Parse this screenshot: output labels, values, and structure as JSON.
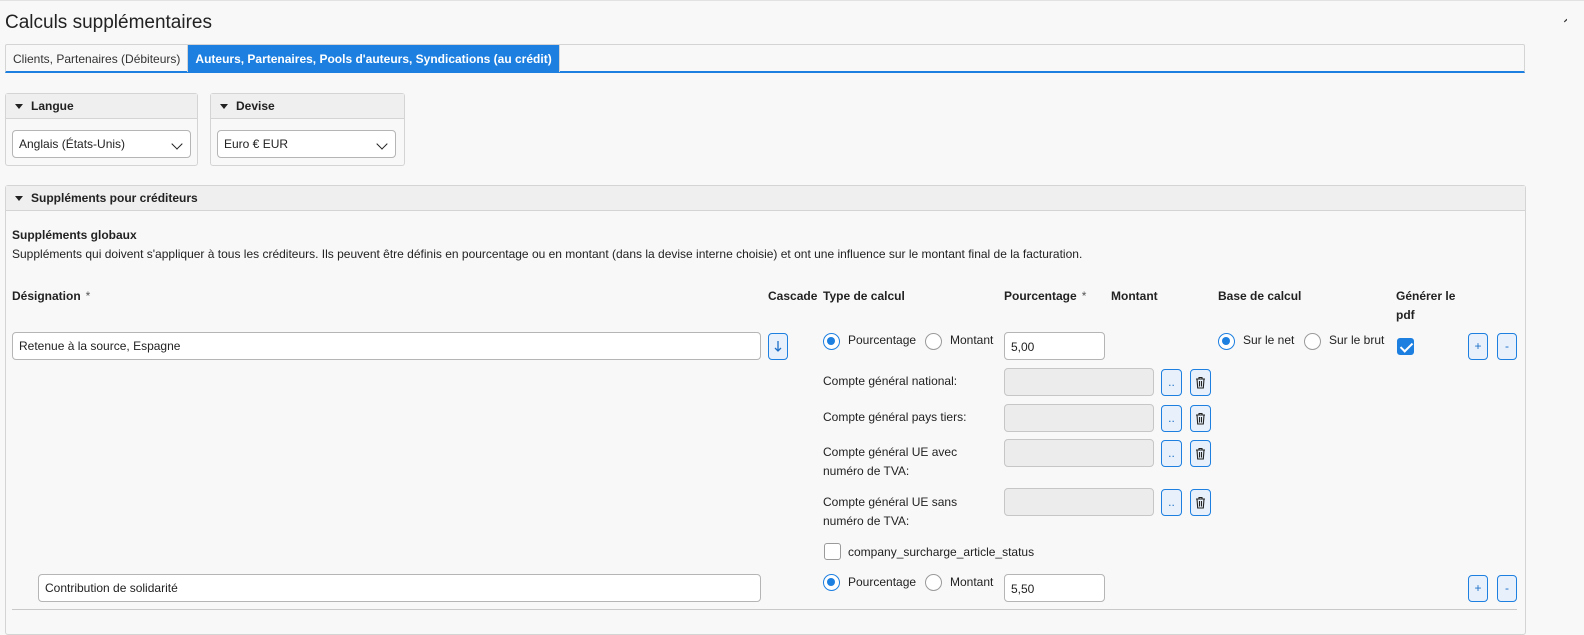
{
  "page": {
    "title": "Calculs supplémentaires"
  },
  "tabs": [
    {
      "label": "Clients, Partenaires (Débiteurs)",
      "active": false
    },
    {
      "label": "Auteurs, Partenaires, Pools d'auteurs, Syndications (au crédit)",
      "active": true
    }
  ],
  "langue": {
    "title": "Langue",
    "selected": "Anglais (États-Unis)"
  },
  "devise": {
    "title": "Devise",
    "selected": "Euro € EUR"
  },
  "supplements": {
    "title": "Suppléments pour créditeurs",
    "global_title": "Suppléments globaux",
    "global_desc": "Suppléments qui doivent s'appliquer à tous les créditeurs. Ils peuvent être définis en pourcentage ou en montant (dans la devise interne choisie) et ont une influence sur le montant final de la facturation.",
    "columns": {
      "designation": "Désignation",
      "required_mark": "*",
      "cascade": "Cascade",
      "type_calcul": "Type de calcul",
      "pourcentage": "Pourcentage",
      "montant": "Montant",
      "base_calcul": "Base de calcul",
      "generer_pdf_1": "Générer le",
      "generer_pdf_2": "pdf"
    },
    "options": {
      "pourcentage": "Pourcentage",
      "montant": "Montant",
      "sur_net": "Sur le net",
      "sur_brut": "Sur le brut"
    },
    "rows": [
      {
        "designation": "Retenue à la source, Espagne",
        "cascade_icon": "arrow-down-icon",
        "type": "pourcentage",
        "pourcentage": "5,00",
        "base": "net",
        "generer_pdf": true,
        "accounts": [
          {
            "label1": "Compte général national:",
            "label2": ""
          },
          {
            "label1": "Compte général pays tiers:",
            "label2": ""
          },
          {
            "label1": "Compte général UE avec",
            "label2": "numéro de TVA:"
          },
          {
            "label1": "Compte général UE sans",
            "label2": "numéro de TVA:"
          }
        ],
        "browse_label": "..",
        "status_label": "company_surcharge_article_status",
        "status_checked": false
      },
      {
        "designation": "Contribution de solidarité",
        "type": "pourcentage",
        "pourcentage": "5,50"
      }
    ],
    "add_label": "+",
    "remove_label": "-"
  },
  "colors": {
    "accent": "#1d7fe0"
  }
}
